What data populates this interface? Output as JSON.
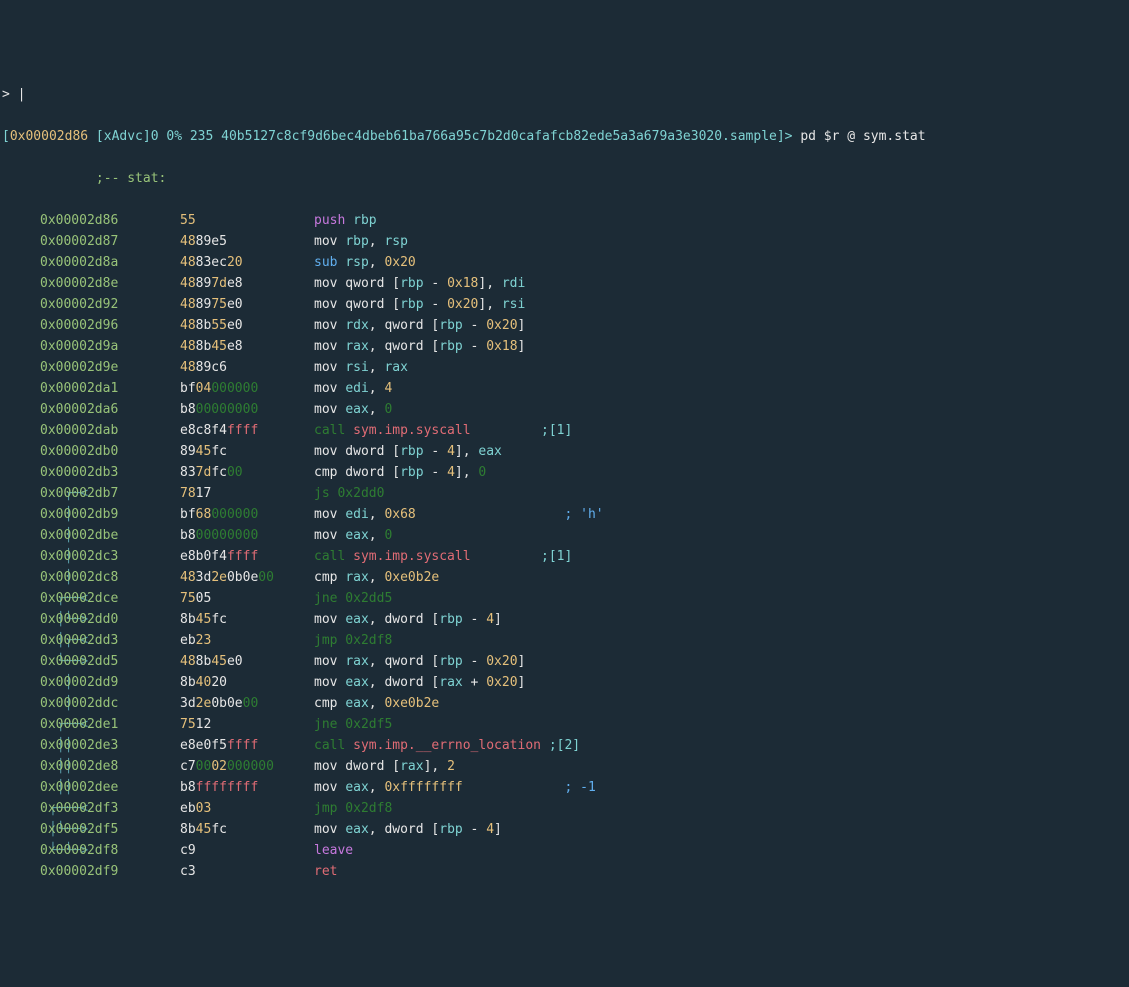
{
  "cursor_line": "> |",
  "prompt": {
    "bracket_open": "[",
    "addr": "0x00002d86 ",
    "status": "[xAdvc]0 0% 235 40b5127c8cf9d6bec4dbeb61ba766a95c7b2d0cafafcb82ede5a3a679a3e3020.sample",
    "bracket_close": "]> ",
    "cmd": "pd $r @ sym.stat"
  },
  "header": "            ;-- stat:",
  "rows": [
    {
      "flow": "      ",
      "addr": "0x00002d86",
      "hex": [
        [
          "y",
          "55"
        ]
      ],
      "ins": [
        [
          "p",
          "push"
        ],
        [
          "w",
          " "
        ],
        [
          "c",
          "rbp"
        ]
      ]
    },
    {
      "flow": "      ",
      "addr": "0x00002d87",
      "hex": [
        [
          "y",
          "48"
        ],
        [
          "w",
          "89e5"
        ]
      ],
      "ins": [
        [
          "w",
          "mov "
        ],
        [
          "c",
          "rbp"
        ],
        [
          "w",
          ", "
        ],
        [
          "c",
          "rsp"
        ]
      ]
    },
    {
      "flow": "      ",
      "addr": "0x00002d8a",
      "hex": [
        [
          "y",
          "48"
        ],
        [
          "w",
          "83ec"
        ],
        [
          "y",
          "20"
        ]
      ],
      "ins": [
        [
          "b",
          "sub"
        ],
        [
          "w",
          " "
        ],
        [
          "c",
          "rsp"
        ],
        [
          "w",
          ", "
        ],
        [
          "y",
          "0x20"
        ]
      ]
    },
    {
      "flow": "      ",
      "addr": "0x00002d8e",
      "hex": [
        [
          "y",
          "48"
        ],
        [
          "w",
          "89"
        ],
        [
          "y",
          "7d"
        ],
        [
          "w",
          "e8"
        ]
      ],
      "ins": [
        [
          "w",
          "mov qword ["
        ],
        [
          "c",
          "rbp"
        ],
        [
          "w",
          " - "
        ],
        [
          "y",
          "0x18"
        ],
        [
          "w",
          "], "
        ],
        [
          "c",
          "rdi"
        ]
      ]
    },
    {
      "flow": "      ",
      "addr": "0x00002d92",
      "hex": [
        [
          "y",
          "48"
        ],
        [
          "w",
          "89"
        ],
        [
          "y",
          "75"
        ],
        [
          "w",
          "e0"
        ]
      ],
      "ins": [
        [
          "w",
          "mov qword ["
        ],
        [
          "c",
          "rbp"
        ],
        [
          "w",
          " - "
        ],
        [
          "y",
          "0x20"
        ],
        [
          "w",
          "], "
        ],
        [
          "c",
          "rsi"
        ]
      ]
    },
    {
      "flow": "      ",
      "addr": "0x00002d96",
      "hex": [
        [
          "y",
          "48"
        ],
        [
          "w",
          "8b"
        ],
        [
          "y",
          "55"
        ],
        [
          "w",
          "e0"
        ]
      ],
      "ins": [
        [
          "w",
          "mov "
        ],
        [
          "c",
          "rdx"
        ],
        [
          "w",
          ", qword ["
        ],
        [
          "c",
          "rbp"
        ],
        [
          "w",
          " - "
        ],
        [
          "y",
          "0x20"
        ],
        [
          "w",
          "]"
        ]
      ]
    },
    {
      "flow": "      ",
      "addr": "0x00002d9a",
      "hex": [
        [
          "y",
          "48"
        ],
        [
          "w",
          "8b"
        ],
        [
          "y",
          "45"
        ],
        [
          "w",
          "e8"
        ]
      ],
      "ins": [
        [
          "w",
          "mov "
        ],
        [
          "c",
          "rax"
        ],
        [
          "w",
          ", qword ["
        ],
        [
          "c",
          "rbp"
        ],
        [
          "w",
          " - "
        ],
        [
          "y",
          "0x18"
        ],
        [
          "w",
          "]"
        ]
      ]
    },
    {
      "flow": "      ",
      "addr": "0x00002d9e",
      "hex": [
        [
          "y",
          "48"
        ],
        [
          "w",
          "89c6"
        ]
      ],
      "ins": [
        [
          "w",
          "mov "
        ],
        [
          "c",
          "rsi"
        ],
        [
          "w",
          ", "
        ],
        [
          "c",
          "rax"
        ]
      ]
    },
    {
      "flow": "      ",
      "addr": "0x00002da1",
      "hex": [
        [
          "w",
          "bf"
        ],
        [
          "y",
          "04"
        ],
        [
          "g",
          "000000"
        ]
      ],
      "ins": [
        [
          "w",
          "mov "
        ],
        [
          "c",
          "edi"
        ],
        [
          "w",
          ", "
        ],
        [
          "y",
          "4"
        ]
      ]
    },
    {
      "flow": "      ",
      "addr": "0x00002da6",
      "hex": [
        [
          "w",
          "b8"
        ],
        [
          "g",
          "00000000"
        ]
      ],
      "ins": [
        [
          "w",
          "mov "
        ],
        [
          "c",
          "eax"
        ],
        [
          "w",
          ", "
        ],
        [
          "g",
          "0"
        ]
      ]
    },
    {
      "flow": "      ",
      "addr": "0x00002dab",
      "hex": [
        [
          "w",
          "e8c8f4"
        ],
        [
          "r",
          "ffff"
        ]
      ],
      "ins": [
        [
          "g",
          "call"
        ],
        [
          "w",
          " "
        ],
        [
          "r",
          "sym.imp.syscall"
        ],
        [
          "pad",
          "         "
        ],
        [
          "c",
          ";[1]"
        ]
      ]
    },
    {
      "flow": "      ",
      "addr": "0x00002db0",
      "hex": [
        [
          "w",
          "89"
        ],
        [
          "y",
          "45"
        ],
        [
          "w",
          "fc"
        ]
      ],
      "ins": [
        [
          "w",
          "mov dword ["
        ],
        [
          "c",
          "rbp"
        ],
        [
          "w",
          " - "
        ],
        [
          "y",
          "4"
        ],
        [
          "w",
          "], "
        ],
        [
          "c",
          "eax"
        ]
      ]
    },
    {
      "flow": "      ",
      "addr": "0x00002db3",
      "hex": [
        [
          "w",
          "83"
        ],
        [
          "y",
          "7d"
        ],
        [
          "w",
          "fc"
        ],
        [
          "g",
          "00"
        ]
      ],
      "ins": [
        [
          "w",
          "cmp dword ["
        ],
        [
          "c",
          "rbp"
        ],
        [
          "w",
          " - "
        ],
        [
          "y",
          "4"
        ],
        [
          "w",
          "], "
        ],
        [
          "g",
          "0"
        ]
      ]
    },
    {
      "flow": "  ┌─< ",
      "addr": "0x00002db7",
      "hex": [
        [
          "y",
          "78"
        ],
        [
          "w",
          "17"
        ]
      ],
      "ins": [
        [
          "g",
          "js 0x2dd0"
        ]
      ]
    },
    {
      "flow": "  │   ",
      "addr": "0x00002db9",
      "hex": [
        [
          "w",
          "bf"
        ],
        [
          "y",
          "68"
        ],
        [
          "g",
          "000000"
        ]
      ],
      "ins": [
        [
          "w",
          "mov "
        ],
        [
          "c",
          "edi"
        ],
        [
          "w",
          ", "
        ],
        [
          "y",
          "0x68"
        ],
        [
          "pad",
          "                   "
        ],
        [
          "b",
          "; 'h'"
        ]
      ]
    },
    {
      "flow": "  │   ",
      "addr": "0x00002dbe",
      "hex": [
        [
          "w",
          "b8"
        ],
        [
          "g",
          "00000000"
        ]
      ],
      "ins": [
        [
          "w",
          "mov "
        ],
        [
          "c",
          "eax"
        ],
        [
          "w",
          ", "
        ],
        [
          "g",
          "0"
        ]
      ]
    },
    {
      "flow": "  │   ",
      "addr": "0x00002dc3",
      "hex": [
        [
          "w",
          "e8b0f4"
        ],
        [
          "r",
          "ffff"
        ]
      ],
      "ins": [
        [
          "g",
          "call"
        ],
        [
          "w",
          " "
        ],
        [
          "r",
          "sym.imp.syscall"
        ],
        [
          "pad",
          "         "
        ],
        [
          "c",
          ";[1]"
        ]
      ]
    },
    {
      "flow": "  │   ",
      "addr": "0x00002dc8",
      "hex": [
        [
          "y",
          "48"
        ],
        [
          "w",
          "3d"
        ],
        [
          "y",
          "2e"
        ],
        [
          "w",
          "0b0e"
        ],
        [
          "g",
          "00"
        ]
      ],
      "ins": [
        [
          "w",
          "cmp "
        ],
        [
          "c",
          "rax"
        ],
        [
          "w",
          ", "
        ],
        [
          "y",
          "0xe0b2e"
        ]
      ]
    },
    {
      "flow": " ┌──< ",
      "addr": "0x00002dce",
      "hex": [
        [
          "y",
          "75"
        ],
        [
          "w",
          "05"
        ]
      ],
      "ins": [
        [
          "g",
          "jne 0x2dd5"
        ]
      ]
    },
    {
      "flow": " │└─> ",
      "addr": "0x00002dd0",
      "hex": [
        [
          "w",
          "8b"
        ],
        [
          "y",
          "45"
        ],
        [
          "w",
          "fc"
        ]
      ],
      "ins": [
        [
          "w",
          "mov "
        ],
        [
          "c",
          "eax"
        ],
        [
          "w",
          ", dword ["
        ],
        [
          "c",
          "rbp"
        ],
        [
          "w",
          " - "
        ],
        [
          "y",
          "4"
        ],
        [
          "w",
          "]"
        ]
      ]
    },
    {
      "flow": " │┌─< ",
      "addr": "0x00002dd3",
      "hex": [
        [
          "w",
          "eb"
        ],
        [
          "y",
          "23"
        ]
      ],
      "ins": [
        [
          "g",
          "jmp 0x2df8"
        ]
      ]
    },
    {
      "flow": " └──> ",
      "addr": "0x00002dd5",
      "hex": [
        [
          "y",
          "48"
        ],
        [
          "w",
          "8b"
        ],
        [
          "y",
          "45"
        ],
        [
          "w",
          "e0"
        ]
      ],
      "ins": [
        [
          "w",
          "mov "
        ],
        [
          "c",
          "rax"
        ],
        [
          "w",
          ", qword ["
        ],
        [
          "c",
          "rbp"
        ],
        [
          "w",
          " - "
        ],
        [
          "y",
          "0x20"
        ],
        [
          "w",
          "]"
        ]
      ]
    },
    {
      "flow": "  │   ",
      "addr": "0x00002dd9",
      "hex": [
        [
          "w",
          "8b"
        ],
        [
          "y",
          "40"
        ],
        [
          "w",
          "20"
        ]
      ],
      "ins": [
        [
          "w",
          "mov "
        ],
        [
          "c",
          "eax"
        ],
        [
          "w",
          ", dword ["
        ],
        [
          "c",
          "rax"
        ],
        [
          "w",
          " + "
        ],
        [
          "y",
          "0x20"
        ],
        [
          "w",
          "]"
        ]
      ]
    },
    {
      "flow": "  │   ",
      "addr": "0x00002ddc",
      "hex": [
        [
          "w",
          "3d"
        ],
        [
          "y",
          "2e"
        ],
        [
          "w",
          "0b0e"
        ],
        [
          "g",
          "00"
        ]
      ],
      "ins": [
        [
          "w",
          "cmp "
        ],
        [
          "c",
          "eax"
        ],
        [
          "w",
          ", "
        ],
        [
          "y",
          "0xe0b2e"
        ]
      ]
    },
    {
      "flow": " ┌──< ",
      "addr": "0x00002de1",
      "hex": [
        [
          "y",
          "75"
        ],
        [
          "w",
          "12"
        ]
      ],
      "ins": [
        [
          "g",
          "jne 0x2df5"
        ]
      ]
    },
    {
      "flow": " ││   ",
      "addr": "0x00002de3",
      "hex": [
        [
          "w",
          "e8e0f5"
        ],
        [
          "r",
          "ffff"
        ]
      ],
      "ins": [
        [
          "g",
          "call"
        ],
        [
          "w",
          " "
        ],
        [
          "r",
          "sym.imp.__errno_location"
        ],
        [
          "w",
          " "
        ],
        [
          "c",
          ";[2]"
        ]
      ]
    },
    {
      "flow": " ││   ",
      "addr": "0x00002de8",
      "hex": [
        [
          "w",
          "c7"
        ],
        [
          "g",
          "00"
        ],
        [
          "y",
          "02"
        ],
        [
          "g",
          "000000"
        ]
      ],
      "ins": [
        [
          "w",
          "mov dword ["
        ],
        [
          "c",
          "rax"
        ],
        [
          "w",
          "], "
        ],
        [
          "y",
          "2"
        ]
      ]
    },
    {
      "flow": " ││   ",
      "addr": "0x00002dee",
      "hex": [
        [
          "w",
          "b8"
        ],
        [
          "r",
          "ffffffff"
        ]
      ],
      "ins": [
        [
          "w",
          "mov "
        ],
        [
          "c",
          "eax"
        ],
        [
          "w",
          ", "
        ],
        [
          "y",
          "0xffffffff"
        ],
        [
          "pad",
          "             "
        ],
        [
          "b",
          "; -1"
        ]
      ]
    },
    {
      "flow": "┌───< ",
      "addr": "0x00002df3",
      "hex": [
        [
          "w",
          "eb"
        ],
        [
          "y",
          "03"
        ]
      ],
      "ins": [
        [
          "g",
          "jmp 0x2df8"
        ]
      ]
    },
    {
      "flow": "│└──> ",
      "addr": "0x00002df5",
      "hex": [
        [
          "w",
          "8b"
        ],
        [
          "y",
          "45"
        ],
        [
          "w",
          "fc"
        ]
      ],
      "ins": [
        [
          "w",
          "mov "
        ],
        [
          "c",
          "eax"
        ],
        [
          "w",
          ", dword ["
        ],
        [
          "c",
          "rbp"
        ],
        [
          "w",
          " - "
        ],
        [
          "y",
          "4"
        ],
        [
          "w",
          "]"
        ]
      ]
    },
    {
      "flow": "└─└─> ",
      "addr": "0x00002df8",
      "hex": [
        [
          "w",
          "c9"
        ]
      ],
      "ins": [
        [
          "p",
          "leave"
        ]
      ]
    },
    {
      "flow": "      ",
      "addr": "0x00002df9",
      "hex": [
        [
          "w",
          "c3"
        ]
      ],
      "ins": [
        [
          "r",
          "ret"
        ]
      ]
    }
  ]
}
